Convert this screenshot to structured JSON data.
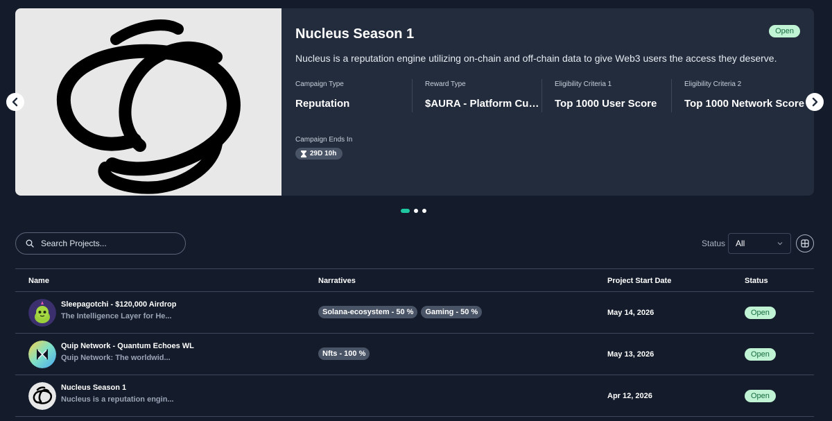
{
  "featured": {
    "title": "Nucleus Season 1",
    "description": "Nucleus is a reputation engine utilizing on-chain and off-chain data to give Web3 users the access they deserve.",
    "status": "Open",
    "meta": [
      {
        "label": "Campaign Type",
        "value": "Reputation"
      },
      {
        "label": "Reward Type",
        "value": "$AURA - Platform Currency"
      },
      {
        "label": "Eligibility Criteria 1",
        "value": "Top 1000 User Score"
      },
      {
        "label": "Eligibility Criteria 2",
        "value": "Top 1000 Network Score"
      }
    ],
    "ends_label": "Campaign Ends In",
    "ends_value": "29D 10h",
    "image_icon": "nucleus-logo"
  },
  "carousel": {
    "slides": 3,
    "active": 0
  },
  "search": {
    "placeholder": "Search Projects..."
  },
  "filter": {
    "label": "Status",
    "selected": "All"
  },
  "table": {
    "headers": {
      "name": "Name",
      "narratives": "Narratives",
      "start_date": "Project Start Date",
      "status": "Status"
    },
    "rows": [
      {
        "name": "Sleepagotchi - $120,000 Airdrop",
        "desc": "The Intelligence Layer for He...",
        "tags": [
          "Solana-ecosystem - 50 %",
          "Gaming - 50 %"
        ],
        "date": "May 14, 2026",
        "status": "Open",
        "avatar_icon": "sleepagotchi-avatar"
      },
      {
        "name": "Quip Network - Quantum Echoes WL",
        "desc": "Quip Network: The worldwid...",
        "tags": [
          "Nfts - 100 %"
        ],
        "date": "May 13, 2026",
        "status": "Open",
        "avatar_icon": "quip-network-avatar"
      },
      {
        "name": "Nucleus Season 1",
        "desc": "Nucleus is a reputation engin...",
        "tags": [],
        "date": "Apr 12, 2026",
        "status": "Open",
        "avatar_icon": "nucleus-avatar"
      }
    ]
  },
  "colors": {
    "background": "#141c2b",
    "card": "#222c3c",
    "accent": "#1fc7a0",
    "open_badge_bg": "#bff3d4",
    "open_badge_text": "#166a3c",
    "tag_bg": "#4a5467"
  }
}
